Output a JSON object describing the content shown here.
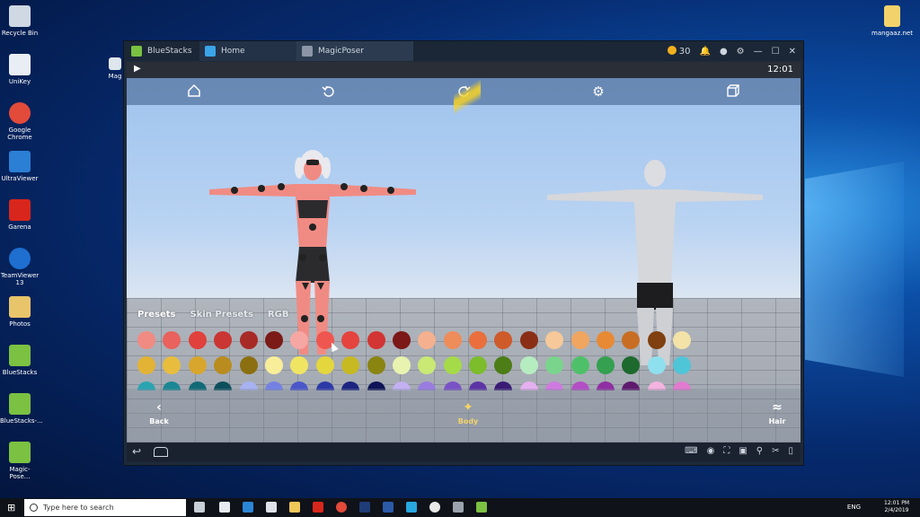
{
  "desktop": {
    "icons_left": [
      {
        "label": "Recycle Bin",
        "icon": "recycle-bin-icon",
        "color": "#cfd8e3"
      },
      {
        "label": "UniKey",
        "icon": "unikey-icon",
        "color": "#e9eef4"
      },
      {
        "label": "Google Chrome",
        "icon": "chrome-icon",
        "color": "#e24a3a"
      },
      {
        "label": "UltraViewer",
        "icon": "ultraviewer-icon",
        "color": "#2b7fd4"
      },
      {
        "label": "Garena",
        "icon": "garena-icon",
        "color": "#d9261c"
      },
      {
        "label": "TeamViewer 13",
        "icon": "teamviewer-icon",
        "color": "#1e6fd0"
      },
      {
        "label": "Photos",
        "icon": "folder-icon",
        "color": "#e8c46a"
      },
      {
        "label": "BlueStacks",
        "icon": "bluestacks-icon",
        "color": "#7bc142"
      },
      {
        "label": "BlueStacks-...",
        "icon": "bluestacks-icon",
        "color": "#7bc142"
      },
      {
        "label": "Magic-Pose...",
        "icon": "bluestacks-icon",
        "color": "#7bc142"
      }
    ],
    "icon_right": {
      "label": "mangaaz.net",
      "icon": "file-icon",
      "color": "#f2d36b"
    },
    "partial_icon_label": "Mag"
  },
  "window": {
    "tabs": [
      {
        "label": "BlueStacks",
        "icon": "bluestacks-icon"
      },
      {
        "label": "Home",
        "icon": "home-icon"
      },
      {
        "label": "MagicPoser",
        "icon": "magicposer-icon"
      }
    ],
    "coins": "30",
    "status_time": "12:01"
  },
  "app": {
    "tabs": [
      "Presets",
      "Skin Presets",
      "RGB"
    ],
    "bottom_nav": {
      "back": "Back",
      "body": "Body",
      "hair": "Hair"
    },
    "swatch_rows": [
      [
        "#f08b83",
        "#e9625d",
        "#e0413c",
        "#c93633",
        "#a82a27",
        "#7b1a17",
        "#f6a6a3",
        "#ef5650",
        "#e5433e",
        "#d23533",
        "#7c1817",
        "#f5b08f",
        "#ee8c5a",
        "#e96f3c",
        "#cf5a2a",
        "#8a2f15",
        "#f6c89a",
        "#f0a660",
        "#e88a34",
        "#c86e24",
        "#80400f",
        "#f3e3a8"
      ],
      [
        "#e3b336",
        "#e8bd3e",
        "#d8a62c",
        "#b88c1f",
        "#8c6f10",
        "#f8ee9a",
        "#f0e563",
        "#e4d63d",
        "#c6b921",
        "#8a8411",
        "#e8f3b0",
        "#c9e974",
        "#a5da48",
        "#7dbc2b",
        "#4c7d16",
        "#b6edc0",
        "#79d58b",
        "#4fc06a",
        "#34a050",
        "#1e6a2e",
        "#8fe0ef",
        "#4fc5d8"
      ],
      [
        "#2aa4b1",
        "#1b8795",
        "#126a77",
        "#0c4f5c",
        "#a8b2f2",
        "#7481e3",
        "#4b57c9",
        "#2c3aa8",
        "#1c2481",
        "#0e1457",
        "#c2b0f2",
        "#9a7ce1",
        "#7a52c7",
        "#5d33a5",
        "#3a1b75",
        "#e5b0f0",
        "#cf7ae0",
        "#b44ec6",
        "#902ea3",
        "#5f1a6d",
        "#f4b3e0",
        "#e37ad0"
      ]
    ],
    "toolbar": {
      "home": "home-icon",
      "undo": "undo-icon",
      "redo": "redo-icon",
      "settings": "gear-icon",
      "cube": "cube-icon"
    }
  },
  "taskbar": {
    "search_placeholder": "Type here to search",
    "lang": "ENG",
    "time": "12:01 PM",
    "date": "2/4/2019"
  },
  "colors": {
    "accent_yellow": "#f2b01e",
    "body_label": "#f2d36b"
  }
}
